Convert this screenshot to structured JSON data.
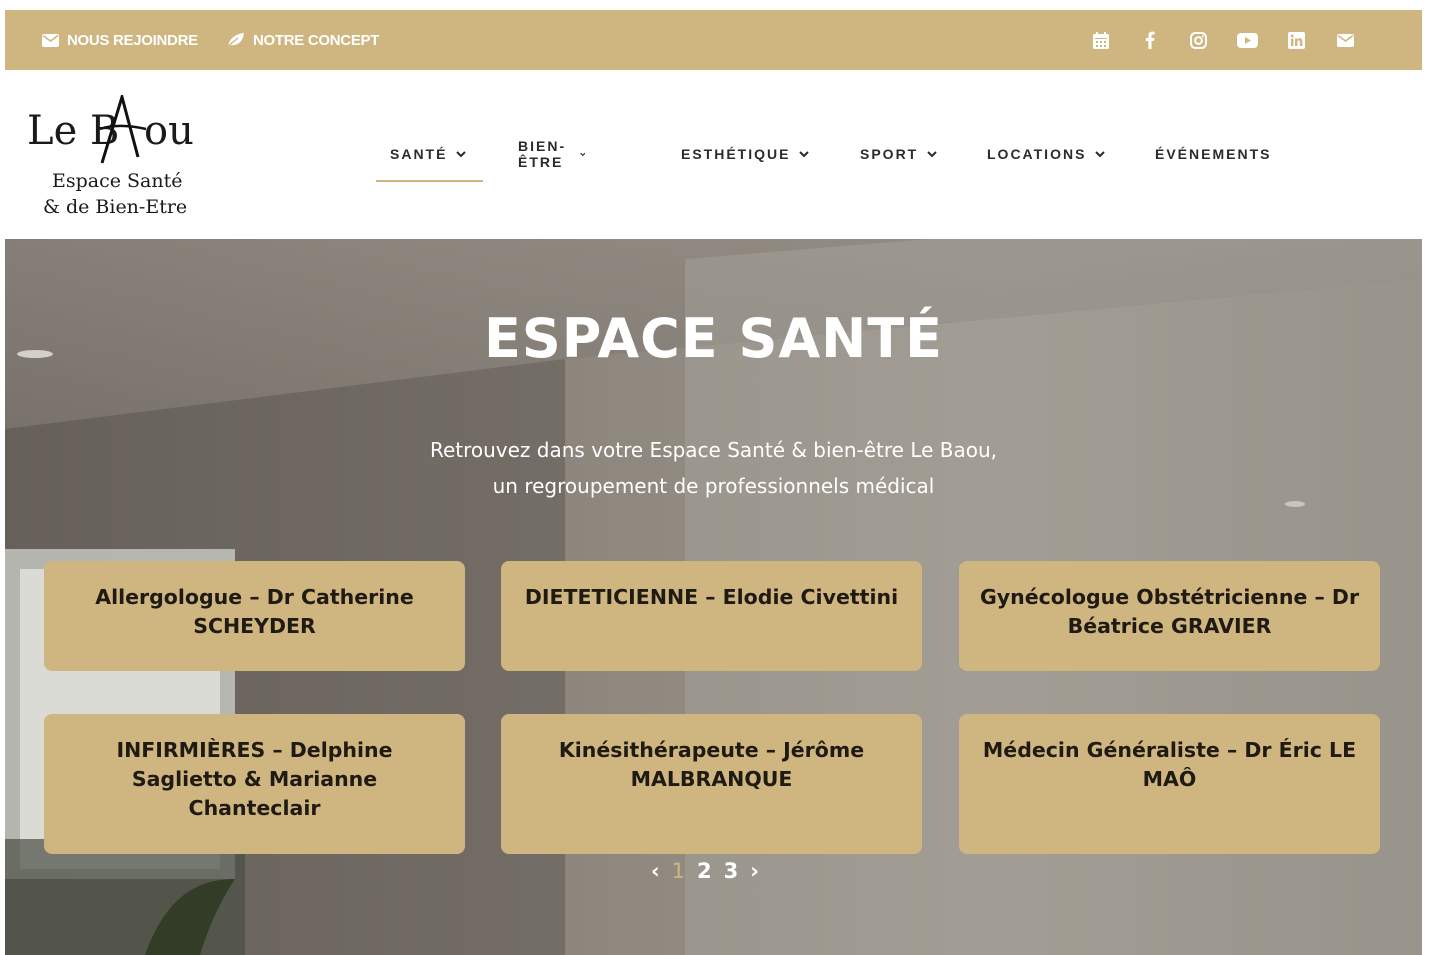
{
  "topbar": {
    "links": [
      {
        "label": "NOUS REJOINDRE",
        "icon": "envelope-icon"
      },
      {
        "label": "NOTRE CONCEPT",
        "icon": "leaf-icon"
      }
    ],
    "social_icons": [
      "calendar-icon",
      "facebook-icon",
      "instagram-icon",
      "youtube-icon",
      "linkedin-icon",
      "envelope-icon"
    ],
    "bg_color": "#cfb580"
  },
  "logo": {
    "name_left": "Le B",
    "name_right": "ou",
    "line1": "Espace Santé",
    "line2": "& de Bien-Etre"
  },
  "nav": {
    "items": [
      {
        "label": "SANTÉ",
        "has_dropdown": true,
        "active": true
      },
      {
        "label": "BIEN-ÊTRE",
        "has_dropdown": true
      },
      {
        "label": "ESTHÉTIQUE",
        "has_dropdown": true
      },
      {
        "label": "SPORT",
        "has_dropdown": true
      },
      {
        "label": "LOCATIONS",
        "has_dropdown": true
      },
      {
        "label": "ÉVÉNEMENTS",
        "has_dropdown": false
      }
    ]
  },
  "hero": {
    "title": "ESPACE SANTÉ",
    "subtitle_line1": "Retrouvez dans votre Espace Santé & bien-être Le Baou,",
    "subtitle_line2": "un regroupement de professionnels médical"
  },
  "cards": [
    {
      "label": "Allergologue – Dr Catherine SCHEYDER"
    },
    {
      "label": "DIETETICIENNE – Elodie Civettini"
    },
    {
      "label": "Gynécologue Obstétricienne – Dr Béatrice GRAVIER"
    },
    {
      "label": "INFIRMIÈRES – Delphine Saglietto & Marianne Chanteclair"
    },
    {
      "label": "Kinésithérapeute – Jérôme MALBRANQUE"
    },
    {
      "label": "Médecin Généraliste – Dr Éric LE MAÔ"
    }
  ],
  "pager": {
    "prev": "‹",
    "pages": [
      "1",
      "2",
      "3"
    ],
    "current": "1",
    "next": "›"
  },
  "colors": {
    "accent": "#cfb580",
    "text_dark": "#2b2b2b"
  }
}
